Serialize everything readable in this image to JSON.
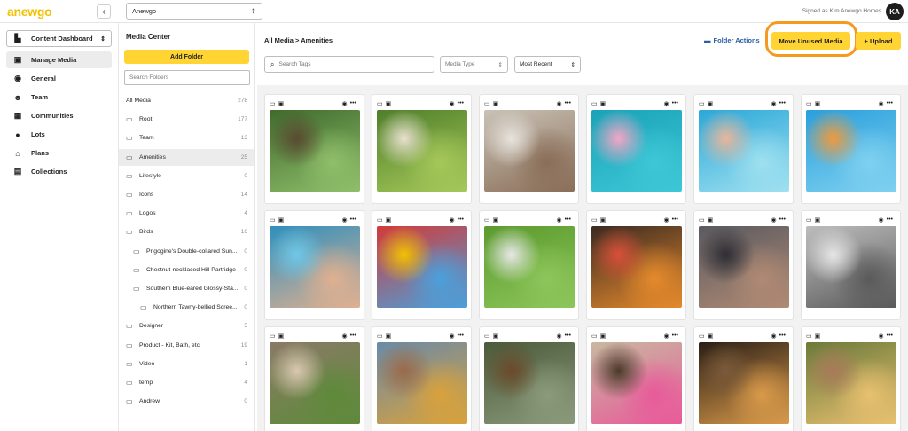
{
  "app": {
    "logo": "anewgo",
    "org_select": "Anewgo",
    "signed_in": "Signed as Kim Anewgo Homes",
    "avatar_initials": "KA"
  },
  "nav": {
    "dashboard_select": "Content Dashboard",
    "items": [
      {
        "label": "Manage Media",
        "icon": "media-icon",
        "glyph": "▣",
        "active": true
      },
      {
        "label": "General",
        "icon": "globe-icon",
        "glyph": "◉"
      },
      {
        "label": "Team",
        "icon": "team-icon",
        "glyph": "☻"
      },
      {
        "label": "Communities",
        "icon": "communities-icon",
        "glyph": "▦"
      },
      {
        "label": "Lots",
        "icon": "pin-icon",
        "glyph": "●"
      },
      {
        "label": "Plans",
        "icon": "home-icon",
        "glyph": "⌂"
      },
      {
        "label": "Collections",
        "icon": "collections-icon",
        "glyph": "▤"
      }
    ]
  },
  "folders": {
    "title": "Media Center",
    "add_label": "Add Folder",
    "search_placeholder": "Search Folders",
    "items": [
      {
        "label": "All Media",
        "count": "278",
        "folder": false
      },
      {
        "label": "Root",
        "count": "177",
        "folder": true
      },
      {
        "label": "Team",
        "count": "13",
        "folder": true
      },
      {
        "label": "Amenities",
        "count": "25",
        "folder": true,
        "active": true
      },
      {
        "label": "Lifestyle",
        "count": "0",
        "folder": true
      },
      {
        "label": "Icons",
        "count": "14",
        "folder": true
      },
      {
        "label": "Logos",
        "count": "4",
        "folder": true
      },
      {
        "label": "Birds",
        "count": "16",
        "folder": true
      },
      {
        "label": "Prigogine's Double-collared Sun...",
        "count": "0",
        "folder": true,
        "level": 1
      },
      {
        "label": "Chestnut-necklaced Hill Partridge",
        "count": "0",
        "folder": true,
        "level": 1
      },
      {
        "label": "Southern Blue-eared Glossy-Sta...",
        "count": "0",
        "folder": true,
        "level": 1
      },
      {
        "label": "Northern Tawny-bellied Scree...",
        "count": "0",
        "folder": true,
        "level": 2
      },
      {
        "label": "Designer",
        "count": "5",
        "folder": true
      },
      {
        "label": "Product - Kit, Bath, etc",
        "count": "19",
        "folder": true
      },
      {
        "label": "Video",
        "count": "1",
        "folder": true
      },
      {
        "label": "temp",
        "count": "4",
        "folder": true
      },
      {
        "label": "Andrew",
        "count": "0",
        "folder": true
      }
    ]
  },
  "main": {
    "breadcrumb": "All Media  >  Amenities",
    "folder_actions": "Folder Actions",
    "move_unused": "Move Unused Media",
    "upload": "+ Upload",
    "search_placeholder": "Search Tags",
    "media_type_placeholder": "Media Type",
    "sort_value": "Most Recent"
  },
  "media": [
    {
      "subject": "forest trail",
      "colors": [
        "#3f6b2e",
        "#8fbf6a",
        "#5a4a30"
      ]
    },
    {
      "subject": "dogs playing",
      "colors": [
        "#4f7f2a",
        "#a6c85a",
        "#e8e0d0"
      ]
    },
    {
      "subject": "friends at party",
      "colors": [
        "#c9c2b6",
        "#8a6e58",
        "#e7e3dd"
      ]
    },
    {
      "subject": "pool float",
      "colors": [
        "#1aa3b8",
        "#3ec7d6",
        "#f2a6c4"
      ]
    },
    {
      "subject": "kids in pool",
      "colors": [
        "#2aa8d8",
        "#9fe0f0",
        "#e9b59a"
      ]
    },
    {
      "subject": "water slide",
      "colors": [
        "#2a9fdc",
        "#7fd1f0",
        "#f09a3c"
      ]
    },
    {
      "subject": "hot tub",
      "colors": [
        "#2e8fbd",
        "#e0b090",
        "#6fc8e8"
      ]
    },
    {
      "subject": "playground swing",
      "colors": [
        "#d23a3a",
        "#4aa0dc",
        "#f2c200"
      ]
    },
    {
      "subject": "kids soccer",
      "colors": [
        "#5b9a2e",
        "#8dc65a",
        "#e8e8e8"
      ]
    },
    {
      "subject": "cocktails",
      "colors": [
        "#3a2a22",
        "#e58a2c",
        "#d94f3a"
      ]
    },
    {
      "subject": "fitness class",
      "colors": [
        "#5a5a60",
        "#b08a74",
        "#2e2e34"
      ]
    },
    {
      "subject": "gym workout",
      "colors": [
        "#bdbdbd",
        "#5a5a5a",
        "#e6e6e6"
      ]
    },
    {
      "subject": "market vegetables",
      "colors": [
        "#8a7a66",
        "#5e8a3a",
        "#d9c9b0"
      ]
    },
    {
      "subject": "shopping woman",
      "colors": [
        "#6a8aa8",
        "#d9a23c",
        "#9a6a4a"
      ]
    },
    {
      "subject": "creek hiking",
      "colors": [
        "#4a5a3a",
        "#8a9a7a",
        "#6a4a2a"
      ]
    },
    {
      "subject": "women shopping",
      "colors": [
        "#c9b8a0",
        "#e85a9a",
        "#4a3a2a"
      ]
    },
    {
      "subject": "dinner table",
      "colors": [
        "#2a1e16",
        "#d99a4a",
        "#7a5a3a"
      ]
    },
    {
      "subject": "outdoor dining",
      "colors": [
        "#6a7a3a",
        "#e8c070",
        "#a87a5a"
      ]
    }
  ]
}
